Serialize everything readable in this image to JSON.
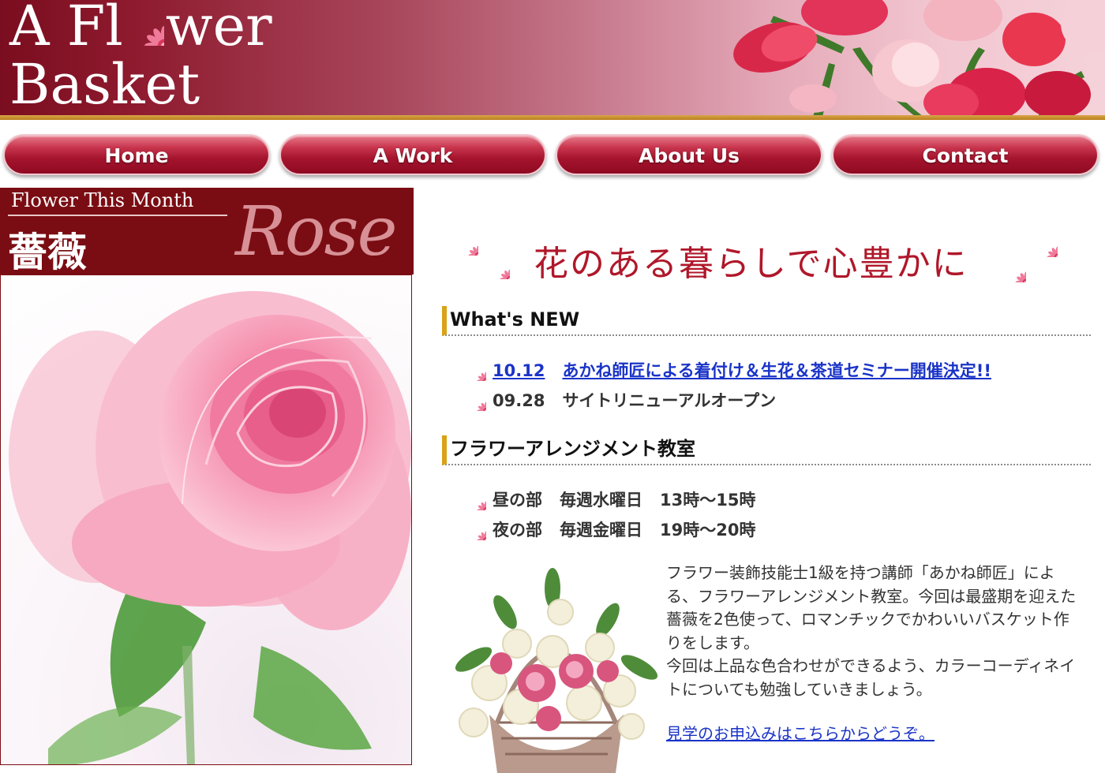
{
  "header": {
    "logo_line1_a": "A Fl",
    "logo_line1_b": "wer",
    "logo_line2": "Basket"
  },
  "nav": {
    "items": [
      {
        "label": "Home"
      },
      {
        "label": "A Work"
      },
      {
        "label": "About Us"
      },
      {
        "label": "Contact"
      }
    ]
  },
  "feature": {
    "caption": "Flower This Month",
    "title_kanji": "薔薇",
    "script": "Rose"
  },
  "main": {
    "tagline": "花のある暮らしで心豊かに",
    "news": {
      "heading": "What's NEW",
      "items": [
        {
          "date": "10.12",
          "text": "あかね師匠による着付け＆生花＆茶道セミナー開催決定!!",
          "is_link": true
        },
        {
          "date": "09.28",
          "text": "サイトリニューアルオープン",
          "is_link": false
        }
      ]
    },
    "class": {
      "heading": "フラワーアレンジメント教室",
      "schedule": [
        {
          "part": "昼の部",
          "day": "毎週水曜日",
          "time": "13時～15時"
        },
        {
          "part": "夜の部",
          "day": "毎週金曜日",
          "time": "19時～20時"
        }
      ],
      "description": "フラワー装飾技能士1級を持つ講師「あかね師匠」による、フラワーアレンジメント教室。今回は最盛期を迎えた薔薇を2色使って、ロマンチックでかわいいバスケット作りをします。",
      "description2": "今回は上品な色合わせができるよう、カラーコーディネイトについても勉強していきましょう。",
      "link": "見学のお申込みはこちらからどうぞ。"
    }
  },
  "colors": {
    "brand_dark": "#7a0d13",
    "accent_gold": "#d8a317",
    "link": "#1a33c8",
    "tagline": "#b0172a"
  }
}
